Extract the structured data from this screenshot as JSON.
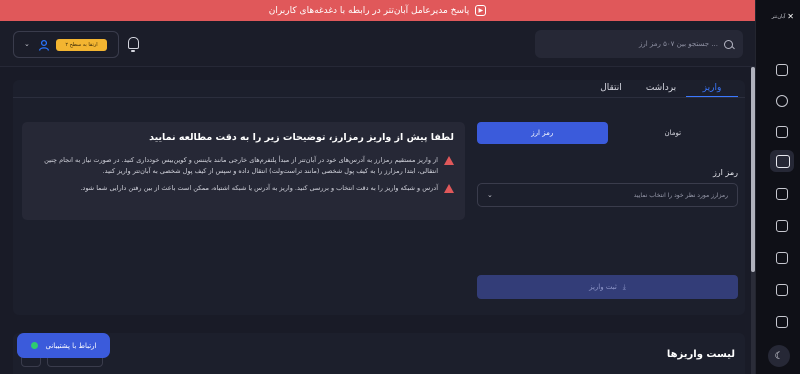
{
  "banner": {
    "text": "پاسخ مدیرعامل آبان‌تتر در رابطه با دغدغه‌های کاربران"
  },
  "header": {
    "search_placeholder": "جستجو بین ۵۰۷ رمز ارز ...",
    "upgrade_label": "ارتقا به سطح ۲"
  },
  "sidebar": {
    "brand": "آبان‌تتر"
  },
  "tabs": [
    "واریز",
    "برداشت",
    "انتقال"
  ],
  "info": {
    "title": "لطفا پیش از واریز رمزارز، توضیحات زیر را به دقت مطالعه نمایید",
    "warnings": [
      "از واریز مستقیم رمزارز به آدرس‌های خود در آبان‌تتر از مبدأ پلتفرم‌های خارجی مانند بایننس و کوین‌بیس خودداری کنید. در صورت نیاز به انجام چنین انتقالی، ابتدا رمزارز را به کیف پول شخصی (مانند تراست‌ولت) انتقال داده و سپس از کیف پول شخصی به آبان‌تتر واریز کنید.",
      "آدرس و شبکه واریز را به دقت انتخاب و بررسی کنید. واریز به آدرس یا شبکه اشتباه، ممکن است باعث از بین رفتن دارایی شما شود."
    ]
  },
  "deposit_form": {
    "options": [
      "تومان",
      "رمز ارز"
    ],
    "selected": "رمز ارز",
    "field_label": "رمز ارز",
    "select_placeholder": "رمزارز مورد نظر خود را انتخاب نمایید",
    "submit_label": "ثبت واریز"
  },
  "deposits_list": {
    "title": "لیست واریزها"
  },
  "support": {
    "label": "ارتباط با پشتیبانی"
  },
  "colors": {
    "accent": "#3b5bdb",
    "banner": "#e0585a",
    "upgrade": "#f3b531",
    "online": "#2ecc71"
  }
}
